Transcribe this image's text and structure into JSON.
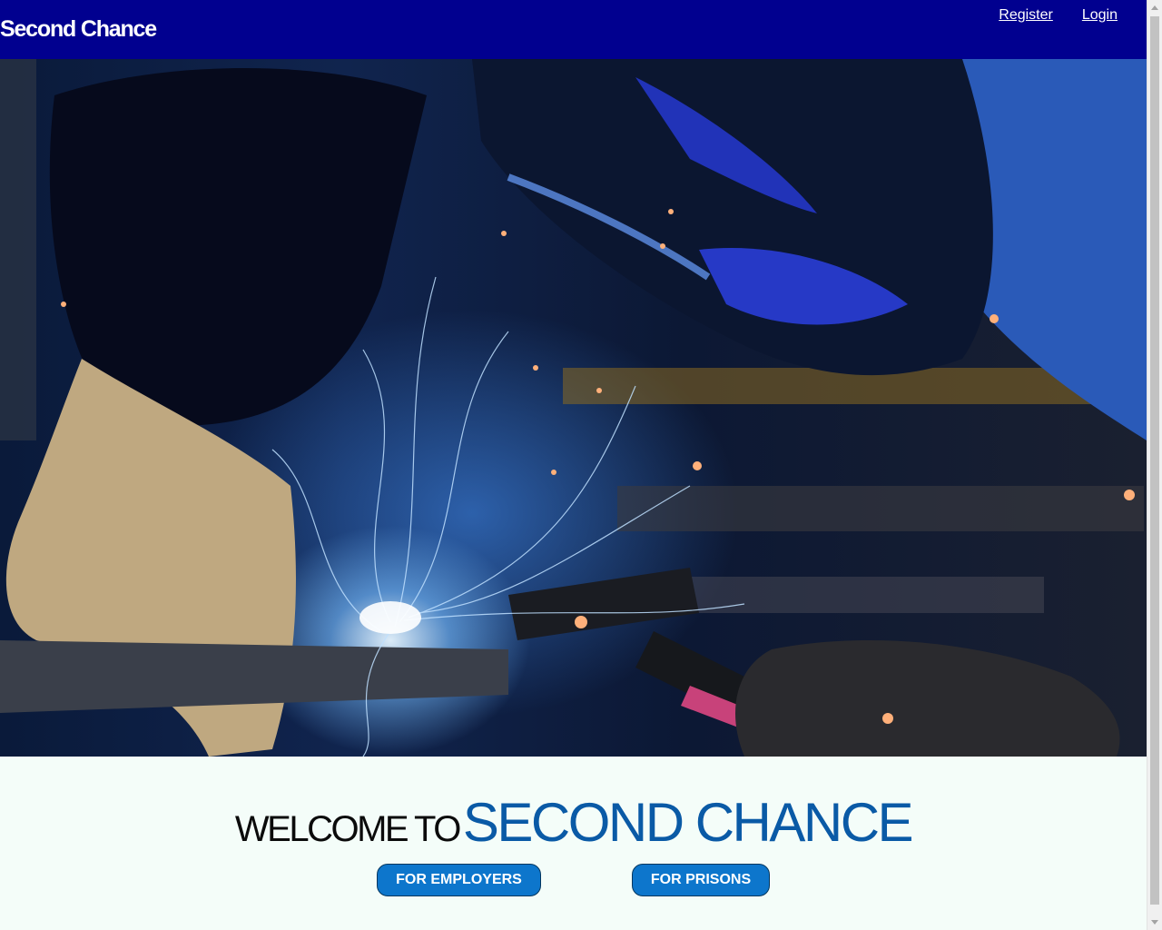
{
  "navbar": {
    "brand": "Second Chance",
    "links": [
      {
        "label": "Register"
      },
      {
        "label": "Login"
      }
    ]
  },
  "hero": {
    "image": "welder-sparks-photo"
  },
  "welcome": {
    "prefix": "WELCOME TO",
    "name": "SECOND CHANCE",
    "buttons": {
      "employers": "FOR EMPLOYERS",
      "prisons": "FOR PRISONS"
    }
  },
  "colors": {
    "navbar_bg": "#01008f",
    "accent_blue": "#0a5aa6",
    "button_bg": "#0d76cc",
    "page_bg": "#f4fdf9"
  }
}
